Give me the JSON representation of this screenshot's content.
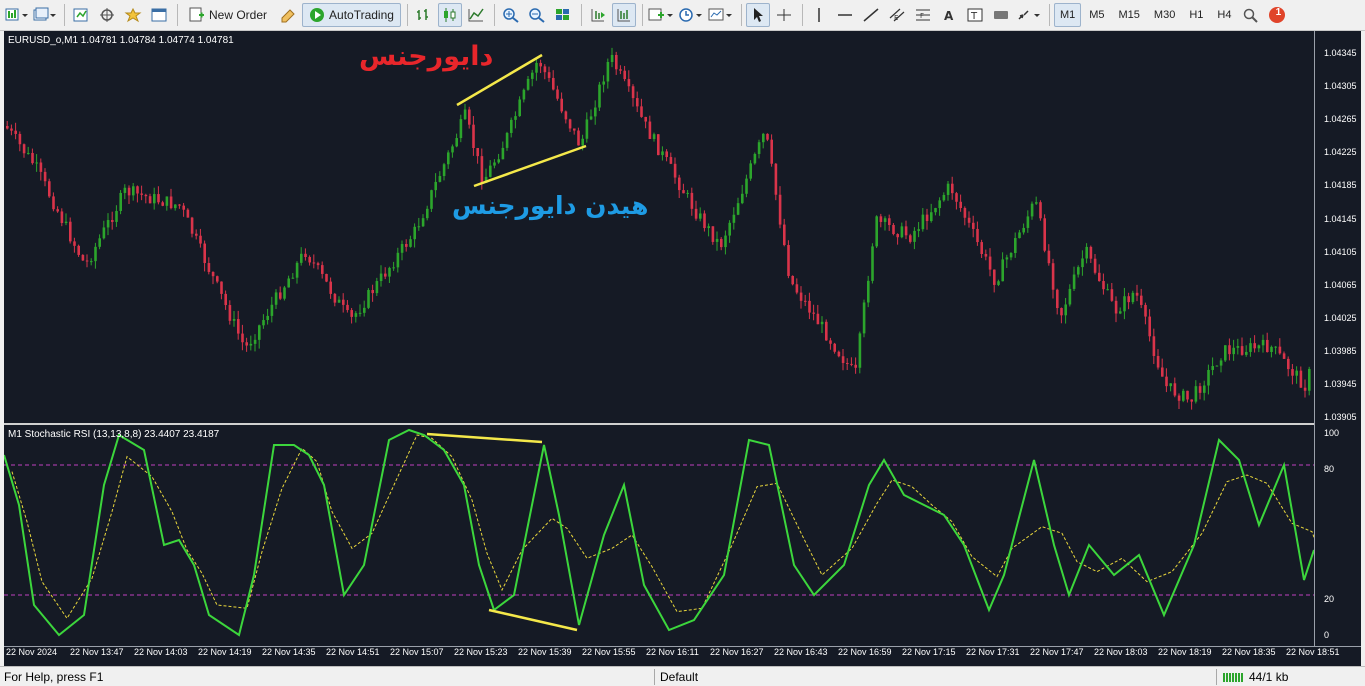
{
  "toolbar": {
    "new_order_label": "New Order",
    "autotrading_label": "AutoTrading",
    "timeframes": [
      "M1",
      "M5",
      "M15",
      "M30",
      "H1",
      "H4"
    ],
    "notification_count": "1"
  },
  "main_chart": {
    "title": "EURUSD_o,M1  1.04781 1.04784 1.04774 1.04781",
    "price_labels": [
      "1.04345",
      "1.04305",
      "1.04265",
      "1.04225",
      "1.04185",
      "1.04145",
      "1.04105",
      "1.04065",
      "1.04025",
      "1.03985",
      "1.03945",
      "1.03905"
    ],
    "annotation_divergence": "دایورجنس",
    "annotation_hidden_divergence": "هیدن دایورجنس",
    "colors": {
      "background": "#151a25",
      "bull": "#2ca52c",
      "bear": "#d9344a",
      "trendline": "#f4e84a",
      "annot_red": "#e8262b",
      "annot_blue": "#1e9be4"
    }
  },
  "indicator": {
    "title": "M1 Stochastic RSI (13,13,8,8) 23.4407 23.4187",
    "levels": [
      "100",
      "80",
      "20",
      "0"
    ],
    "colors": {
      "main": "#3cd63c",
      "signal": "#e8d63c",
      "level": "#c040c0"
    }
  },
  "time_axis": {
    "labels": [
      "22 Nov 2024",
      "22 Nov 13:47",
      "22 Nov 14:03",
      "22 Nov 14:19",
      "22 Nov 14:35",
      "22 Nov 14:51",
      "22 Nov 15:07",
      "22 Nov 15:23",
      "22 Nov 15:39",
      "22 Nov 15:55",
      "22 Nov 16:11",
      "22 Nov 16:27",
      "22 Nov 16:43",
      "22 Nov 16:59",
      "22 Nov 17:15",
      "22 Nov 17:31",
      "22 Nov 17:47",
      "22 Nov 18:03",
      "22 Nov 18:19",
      "22 Nov 18:35",
      "22 Nov 18:51"
    ]
  },
  "status_bar": {
    "help_text": "For Help, press F1",
    "profile": "Default",
    "traffic": "44/1 kb"
  }
}
